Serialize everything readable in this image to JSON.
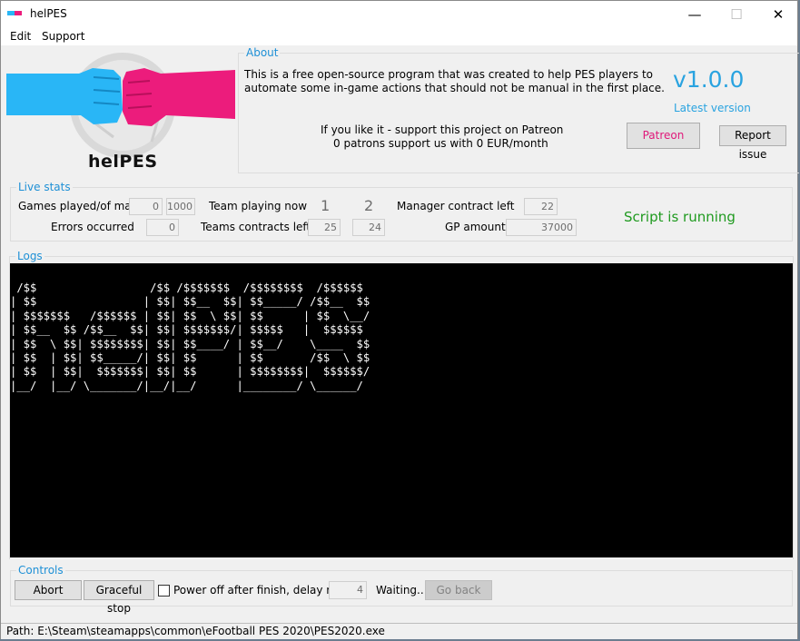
{
  "window": {
    "title": "helPES",
    "minimize": "—",
    "maximize": "☐",
    "close": "✕"
  },
  "menu": {
    "items": [
      "Edit",
      "Support"
    ]
  },
  "logo": {
    "text": "helPES",
    "colors": {
      "left_fist": "#29b6f6",
      "right_fist": "#ec1c7c",
      "ball": "#d9d9d9"
    }
  },
  "about": {
    "legend": "About",
    "description_line1": "This is a free open-source program that was created to help PES players to",
    "description_line2": "automate some in-game actions that should not be manual in the first place.",
    "support_line1": "If you like it - support this project on Patreon",
    "support_line2": "0 patrons support us with 0 EUR/month",
    "version": "v1.0.0",
    "version_status": "Latest version",
    "patreon_button": "Patreon",
    "report_button": "Report issue"
  },
  "live_stats": {
    "legend": "Live stats",
    "games_label": "Games played/of max",
    "games_played": "0",
    "games_max": "1000",
    "errors_label": "Errors occurred",
    "errors": "0",
    "team_playing_label": "Team playing now",
    "team1": "1",
    "team2": "2",
    "teams_contracts_label": "Teams contracts left",
    "team1_contracts": "25",
    "team2_contracts": "24",
    "manager_contract_label": "Manager contract left",
    "manager_contract": "22",
    "gp_label": "GP amount",
    "gp": "37000",
    "script_status": "Script is running"
  },
  "logs": {
    "legend": "Logs",
    "ascii_lines": [
      " /$$                 /$$ /$$$$$$$  /$$$$$$$$  /$$$$$$ ",
      "| $$                | $$| $$__  $$| $$_____/ /$$__  $$",
      "| $$$$$$$   /$$$$$$ | $$| $$  \\ $$| $$      | $$  \\__/",
      "| $$__  $$ /$$__  $$| $$| $$$$$$$/| $$$$$   |  $$$$$$ ",
      "| $$  \\ $$| $$$$$$$$| $$| $$____/ | $$__/    \\____  $$",
      "| $$  | $$| $$_____/| $$| $$      | $$       /$$  \\ $$",
      "| $$  | $$|  $$$$$$$| $$| $$      | $$$$$$$$|  $$$$$$/",
      "|__/  |__/ \\_______/|__/|__/      |________/ \\______/ "
    ]
  },
  "controls": {
    "legend": "Controls",
    "abort_button": "Abort",
    "graceful_button": "Graceful stop",
    "power_off_label": "Power off after finish, delay m:",
    "power_off_checked": false,
    "delay": "4",
    "status": "Waiting..",
    "go_back_button": "Go back"
  },
  "statusbar": {
    "path": "Path: E:\\Steam\\steamapps\\common\\eFootball PES 2020\\PES2020.exe"
  }
}
